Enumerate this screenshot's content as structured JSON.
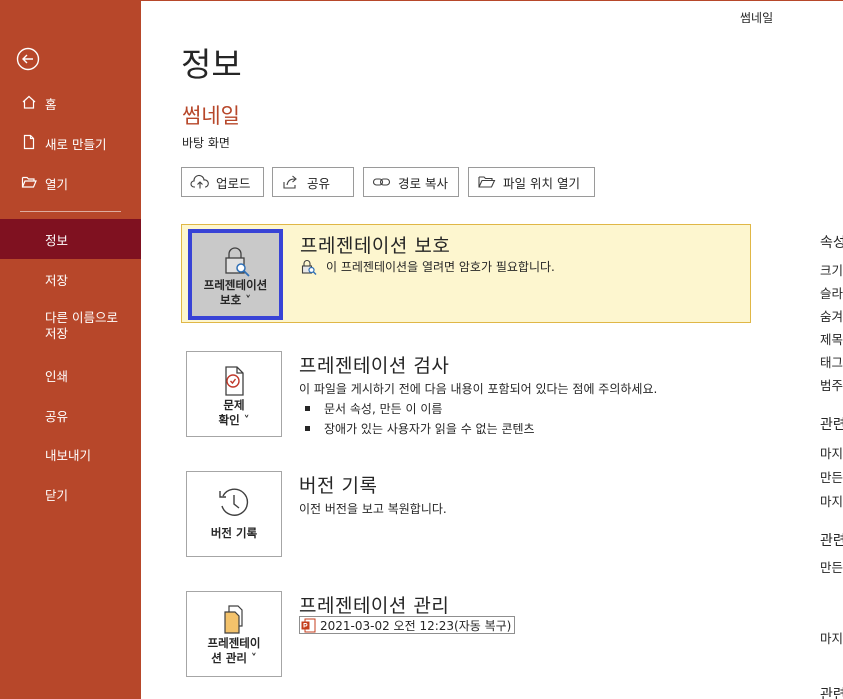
{
  "app": {
    "accent": "#b7472a",
    "active_nav_color": "#7f1120"
  },
  "user": {
    "name": "썸네일"
  },
  "sidebar": {
    "back_icon": "back-arrow-icon",
    "items": [
      {
        "label": "홈",
        "icon": "home-icon"
      },
      {
        "label": "새로 만들기",
        "icon": "new-file-icon"
      },
      {
        "label": "열기",
        "icon": "folder-open-icon"
      },
      {
        "label": "정보",
        "active": true
      },
      {
        "label": "저장"
      },
      {
        "label": "다른 이름으로 저장"
      },
      {
        "label": "인쇄"
      },
      {
        "label": "공유"
      },
      {
        "label": "내보내기"
      },
      {
        "label": "닫기"
      }
    ],
    "save_as_line1": "다른 이름으로",
    "save_as_line2": "저장"
  },
  "page": {
    "title": "정보"
  },
  "document": {
    "name": "썸네일",
    "location": "바탕 화면"
  },
  "actions": [
    {
      "label": "업로드",
      "icon": "cloud-upload-icon"
    },
    {
      "label": "공유",
      "icon": "share-icon"
    },
    {
      "label": "경로 복사",
      "icon": "link-icon"
    },
    {
      "label": "파일 위치 열기",
      "icon": "folder-icon"
    }
  ],
  "sections": {
    "protect": {
      "button_line1": "프레젠테이션",
      "button_line2": "보호 ˅",
      "title": "프레젠테이션 보호",
      "description": "이 프레젠테이션을 열려면 암호가 필요합니다."
    },
    "inspect": {
      "button_line1": "문제",
      "button_line2": "확인 ˅",
      "title": "프레젠테이션 검사",
      "description": "이 파일을 게시하기 전에 다음 내용이 포함되어 있다는 점에 주의하세요.",
      "bullets": [
        "문서 속성, 만든 이 이름",
        "장애가 있는 사용자가 읽을 수 없는 콘텐츠"
      ]
    },
    "versions": {
      "button_label": "버전 기록",
      "title": "버전 기록",
      "description": "이전 버전을 보고 복원합니다."
    },
    "manage": {
      "button_line1": "프레젠테이",
      "button_line2": "션 관리 ˅",
      "title": "프레젠테이션 관리",
      "autosave": "2021-03-02 오전 12:23(자동 복구)"
    }
  },
  "properties": {
    "header": "속성",
    "rows": [
      "크기",
      "슬라",
      "숨겨",
      "제목",
      "태그",
      "범주"
    ],
    "dates_header": "관련",
    "date_rows": [
      "마지",
      "만든",
      "마지"
    ],
    "people_header": "관련",
    "people_rows": [
      "만든"
    ],
    "last_modified": "마지",
    "docs_header": "관련"
  }
}
